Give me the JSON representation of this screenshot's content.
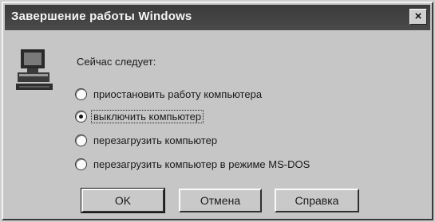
{
  "window": {
    "title": "Завершение работы Windows",
    "close_label": "×"
  },
  "prompt": "Сейчас следует:",
  "options": [
    {
      "label": "приостановить работу компьютера",
      "checked": false
    },
    {
      "label": "выключить компьютер",
      "checked": true
    },
    {
      "label": "перезагрузить компьютер",
      "checked": false
    },
    {
      "label": "перезагрузить компьютер в режиме MS-DOS",
      "checked": false
    }
  ],
  "buttons": {
    "ok": "OK",
    "cancel": "Отмена",
    "help": "Справка"
  }
}
